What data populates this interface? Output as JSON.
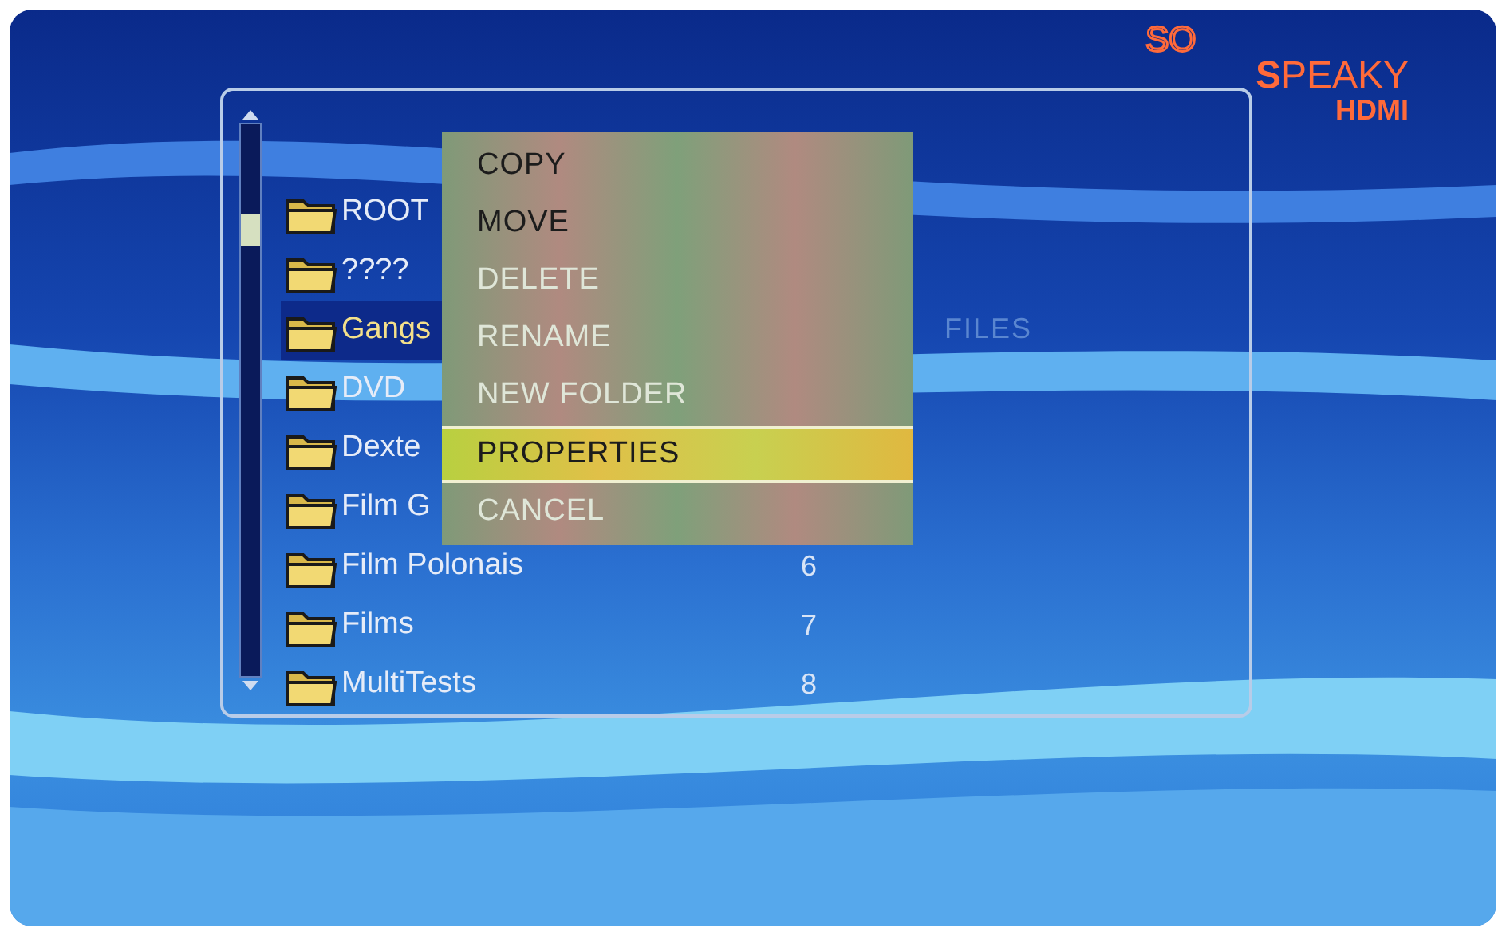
{
  "logo": {
    "line_1": "SO",
    "line_2": "**S**PEAKY",
    "line_3": "HDMI"
  },
  "file_list": {
    "column_header": "FILES",
    "rows": [
      {
        "name": "ROOT",
        "selected": false
      },
      {
        "name": "????",
        "selected": false
      },
      {
        "name": "Gangs",
        "selected": true
      },
      {
        "name": "DVD",
        "selected": false
      },
      {
        "name": "Dexte",
        "selected": false
      },
      {
        "name": "Film G",
        "selected": false
      },
      {
        "name": "Film Polonais",
        "number": "6",
        "selected": false
      },
      {
        "name": "Films",
        "number": "7",
        "selected": false
      },
      {
        "name": "MultiTests",
        "number": "8",
        "selected": false
      }
    ]
  },
  "context_menu": {
    "items": [
      {
        "label": "COPY",
        "dimmed": false,
        "selected": false
      },
      {
        "label": "MOVE",
        "dimmed": false,
        "selected": false
      },
      {
        "label": "DELETE",
        "dimmed": true,
        "selected": false
      },
      {
        "label": "RENAME",
        "dimmed": true,
        "selected": false
      },
      {
        "label": "NEW FOLDER",
        "dimmed": true,
        "selected": false
      },
      {
        "label": "PROPERTIES",
        "dimmed": false,
        "selected": true
      },
      {
        "label": "CANCEL",
        "dimmed": true,
        "selected": false
      }
    ]
  }
}
